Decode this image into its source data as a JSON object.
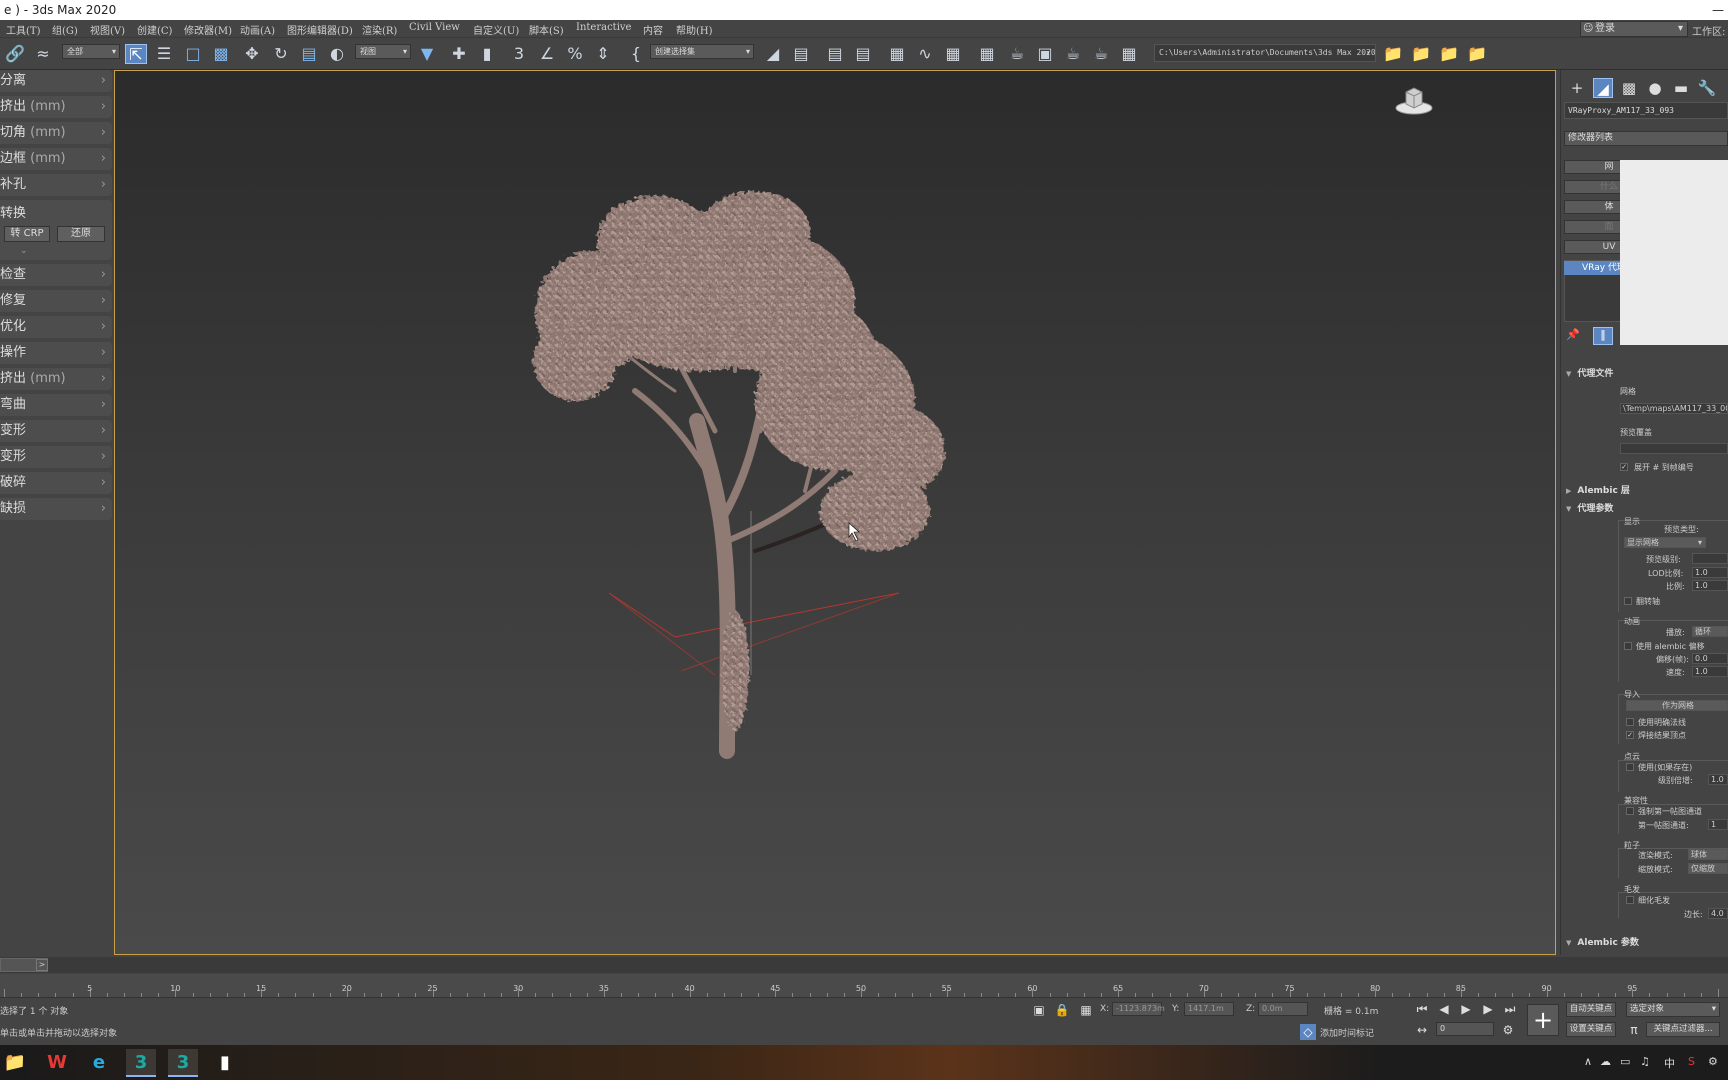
{
  "window": {
    "title": "e ) - 3ds Max 2020",
    "min": "—"
  },
  "menu": [
    "工具(T)",
    "组(G)",
    "视图(V)",
    "创建(C)",
    "修改器(M)",
    "动画(A)",
    "图形编辑器(D)",
    "渲染(R)",
    "Civil View",
    "自定义(U)",
    "脚本(S)",
    "Interactive",
    "内容",
    "帮助(H)"
  ],
  "login": {
    "label": "登录",
    "workspace": "工作区:"
  },
  "toolbar": {
    "filter": "全部",
    "refcoord": "视图",
    "selset": "创建选择集",
    "path": "C:\\Users\\Administrator\\Documents\\3ds Max 2020"
  },
  "left_panel": {
    "items": [
      {
        "text": "分离"
      },
      {
        "text": "挤出",
        "unit": "(mm)"
      },
      {
        "text": "切角",
        "unit": "(mm)"
      },
      {
        "text": "边框",
        "unit": "(mm)"
      },
      {
        "text": "补孔"
      },
      {
        "text": "转换"
      },
      {
        "text": "检查"
      },
      {
        "text": "修复"
      },
      {
        "text": "优化"
      },
      {
        "text": "操作"
      },
      {
        "text": "挤出",
        "unit": "(mm)"
      },
      {
        "text": "弯曲"
      },
      {
        "text": "变形"
      },
      {
        "text": "变形"
      },
      {
        "text": "破碎"
      },
      {
        "text": "缺损"
      }
    ],
    "btn_crp": "转 CRP",
    "btn_restore": "还原",
    "expand": "⌄"
  },
  "command_panel": {
    "object_name": "VRayProxy_AM117_33_093",
    "modifier_list": "修改器列表",
    "mod_buttons": [
      "网",
      "什么",
      "体",
      "面",
      "UV"
    ],
    "stack_item": "VRay 代理",
    "rollouts": {
      "proxy_file": "代理文件",
      "mesh_label": "网格",
      "mesh_path": "\\Temp\\maps\\AM117_33_00.",
      "preview_override": "预览覆盖",
      "expand_frame": "展开 # 到帧编号",
      "alembic_layers": "Alembic 层",
      "proxy_params": "代理参数",
      "display": "显示",
      "preview_type": "预览类型:",
      "preview_type_value": "显示网格",
      "preview_level": "预览级别:",
      "lod_ratio": "LOD比例:",
      "lod_ratio_value": "1.0",
      "ratio": "比例:",
      "ratio_value": "1.0",
      "flip_axis": "翻转轴",
      "animation": "动画",
      "playback": "播放:",
      "playback_value": "循环",
      "use_alembic_offset": "使用 alembic 偏移",
      "offset_frames": "偏移(帧):",
      "offset_value": "0.0",
      "speed": "速度:",
      "speed_value": "1.0",
      "import": "导入",
      "as_mesh": "作为网格",
      "use_explicit_normals": "使用明确法线",
      "weld_vertices": "焊接结果顶点",
      "point_cloud": "点云",
      "use_if_exists": "使用(如果存在)",
      "level_mult": "级别倍增:",
      "level_mult_value": "1.0",
      "compat": "兼容性",
      "force_first_map": "强制第一帖图通道",
      "first_map_channel": "第一帖图通道:",
      "first_map_value": "1",
      "particles": "粒子",
      "render_mode": "渲染模式:",
      "render_mode_value": "球体",
      "scale_mode": "缩放模式:",
      "scale_mode_value": "仅缩放",
      "hair": "毛发",
      "tessellate_hair": "细化毛发",
      "edge_len": "边长:",
      "edge_len_value": "4.0",
      "alembic_params": "Alembic 参数"
    }
  },
  "timeline": {
    "ticks": [
      "5",
      "10",
      "15",
      "20",
      "25",
      "30",
      "35",
      "40",
      "45",
      "50",
      "55",
      "60",
      "65",
      "70",
      "75",
      "80",
      "85",
      "90",
      "95"
    ]
  },
  "status": {
    "selected": "选择了 1 个 对象",
    "hint": "单击或单击并拖动以选择对象",
    "x_label": "X:",
    "x_value": "-1123.873m",
    "y_label": "Y:",
    "y_value": "1417.1m",
    "z_label": "Z:",
    "z_value": "0.0m",
    "grid": "栅格 = 0.1m",
    "add_time_tag": "添加时间标记",
    "auto_key": "自动关键点",
    "selected_objects": "选定对象",
    "set_key": "设置关键点",
    "key_filters": "关键点过滤器...",
    "frame": "0"
  },
  "taskbar": {
    "ime": "中",
    "apps": [
      "folder-icon",
      "wps-icon",
      "edge-icon",
      "max-icon",
      "max-icon-2",
      "file-icon"
    ]
  },
  "colors": {
    "accent": "#5b86c2",
    "viewport_border": "#c8a24a",
    "gizmo": "#b5372e",
    "tree": "#9c8680"
  }
}
